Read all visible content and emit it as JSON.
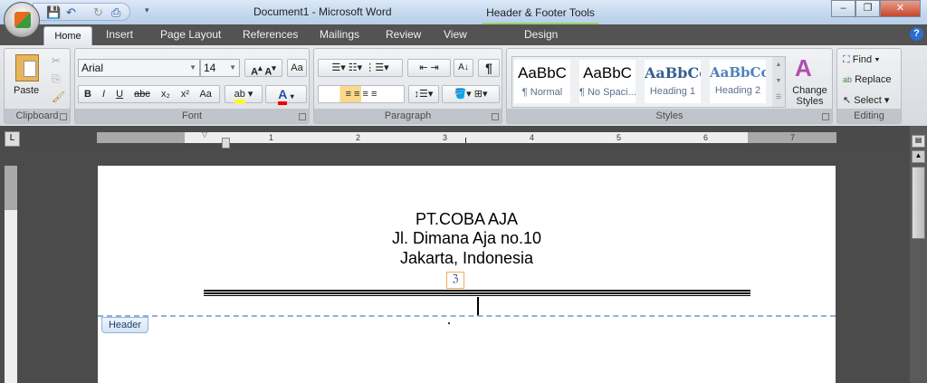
{
  "window": {
    "title": "Document1 - Microsoft Word",
    "context_tool": "Header & Footer Tools"
  },
  "tabs": [
    "Home",
    "Insert",
    "Page Layout",
    "References",
    "Mailings",
    "Review",
    "View"
  ],
  "context_tab": "Design",
  "clipboard": {
    "paste": "Paste",
    "label": "Clipboard"
  },
  "font": {
    "name": "Arial",
    "size": "14",
    "label": "Font",
    "bold": "B",
    "italic": "I",
    "underline": "U",
    "strike": "abc",
    "sub": "x₂",
    "sup": "x²",
    "case": "Aa",
    "grow": "A^",
    "shrink": "Aˇ"
  },
  "paragraph": {
    "label": "Paragraph",
    "pilcrow": "¶"
  },
  "styles": {
    "label": "Styles",
    "items": [
      {
        "sample": "AaBbC",
        "name": "¶ Normal"
      },
      {
        "sample": "AaBbC",
        "name": "¶ No Spaci..."
      },
      {
        "sample": "AaBbCc",
        "name": "Heading 1"
      },
      {
        "sample": "AaBbCc",
        "name": "Heading 2"
      }
    ],
    "change": "Change Styles"
  },
  "editing": {
    "label": "Editing",
    "find": "Find",
    "replace": "Replace",
    "select": "Select"
  },
  "ruler": {
    "numbers": [
      "1",
      "2",
      "3",
      "4",
      "5",
      "6",
      "7"
    ]
  },
  "document": {
    "header_lines": [
      "PT.COBA AJA",
      "Jl. Dimana Aja no.10",
      "Jakarta, Indonesia"
    ],
    "header_tab": "Header"
  },
  "colors": {
    "accent": "#9ad067",
    "highlight": "#ffff00",
    "font_color": "#e00000"
  }
}
